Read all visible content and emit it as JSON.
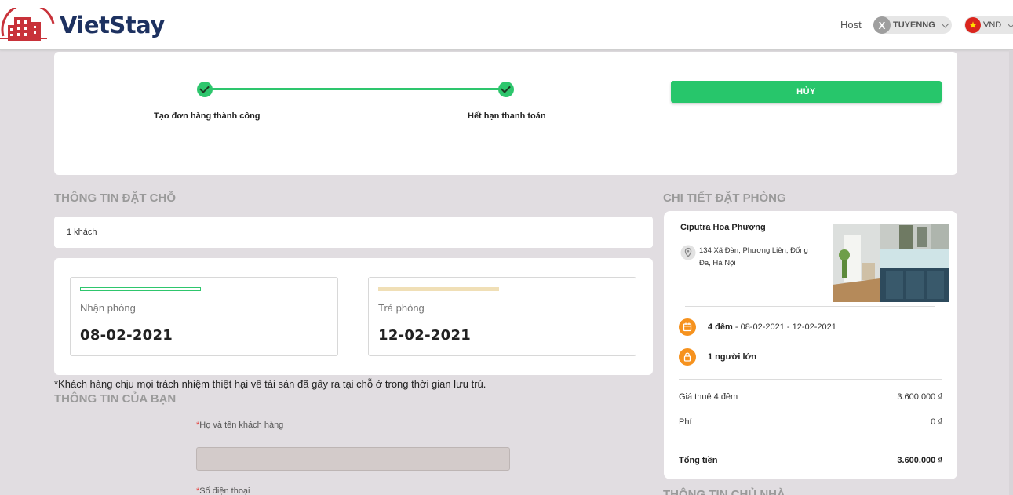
{
  "header": {
    "brand": "VietStay",
    "host_link": "Host",
    "user": {
      "avatar_letter": "X",
      "name": "TUYENNG"
    },
    "currency": {
      "code": "VND"
    }
  },
  "progress": {
    "steps": [
      {
        "label": "Tạo đơn hàng thành công",
        "done": true
      },
      {
        "label": "Hết hạn thanh toán",
        "done": true
      }
    ],
    "cancel_label": "HỦY",
    "accent": "#2ec66d"
  },
  "booking_info": {
    "title": "THÔNG TIN ĐẶT CHỖ",
    "guests": "1 khách",
    "checkin": {
      "label": "Nhận phòng",
      "date": "08-02-2021"
    },
    "checkout": {
      "label": "Trả phòng",
      "date": "12-02-2021"
    },
    "disclaimer": "*Khách hàng chịu mọi trách nhiệm thiệt hại về tài sản đã gây ra tại chỗ ở trong thời gian lưu trú."
  },
  "your_info": {
    "title": "THÔNG TIN CỦA BẠN",
    "name_label": "Họ và tên khách hàng",
    "name_value": "",
    "phone_label": "Số điện thoại",
    "required_mark": "*"
  },
  "details": {
    "title": "CHI TIẾT ĐẶT PHÒNG",
    "hotel_name": "Ciputra Hoa Phượng",
    "address": "134 Xã Đàn, Phương Liên, Đống Đa, Hà Nội",
    "nights_bold": "4 đêm",
    "date_range": " - 08-02-2021 - 12-02-2021",
    "guests_bold": "1 người lớn",
    "rent_label": "Giá thuê 4 đêm",
    "rent_value": "3.600.000 ₫",
    "fee_label": "Phí",
    "fee_value": "0 ₫",
    "total_label": "Tổng tiền",
    "total_value": "3.600.000 ₫",
    "icon_color": "#f6921e"
  },
  "host_info": {
    "title": "THÔNG TIN CHỦ NHÀ"
  }
}
